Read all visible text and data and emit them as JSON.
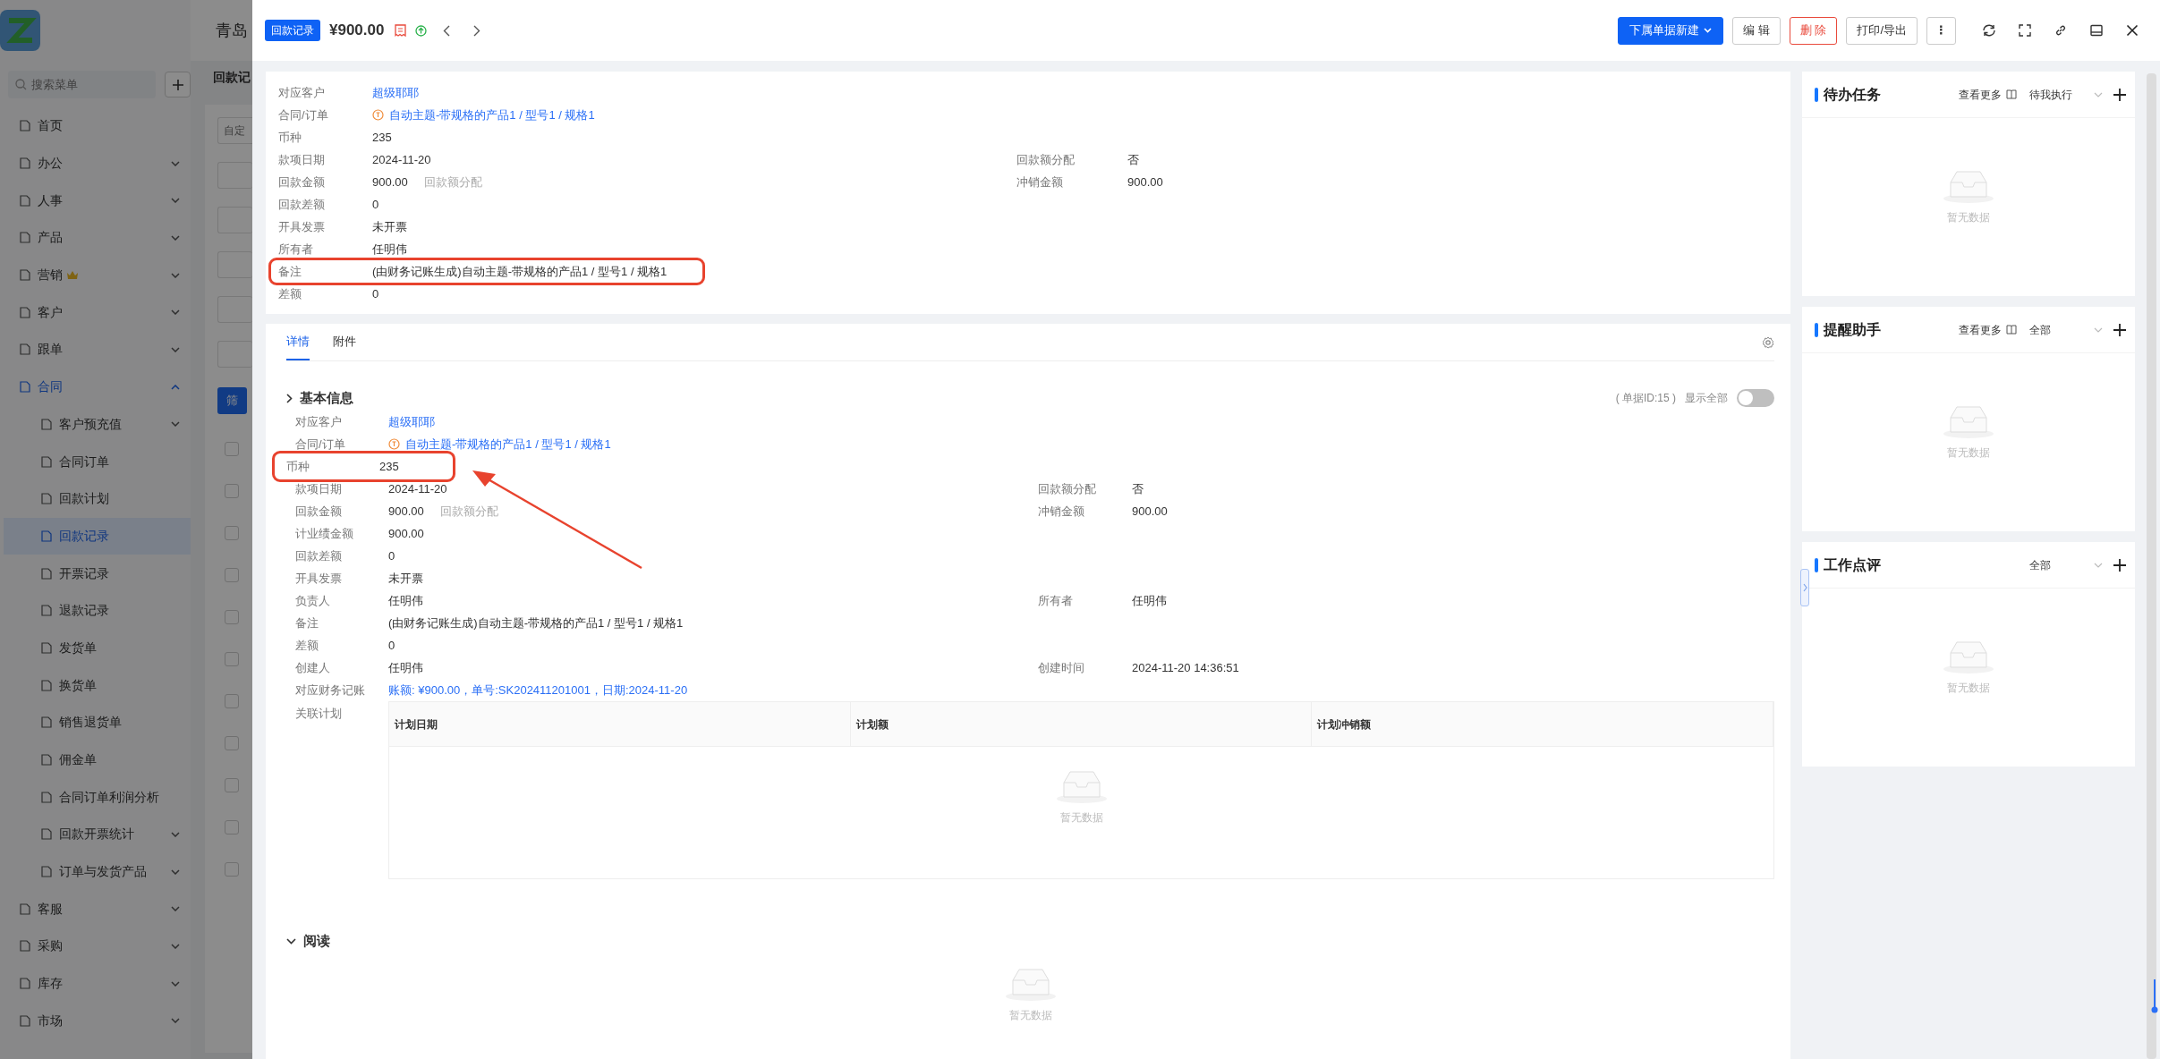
{
  "background_app": {
    "title": "青岛",
    "search": {
      "placeholder": "搜索菜单"
    },
    "page_title": "回款记",
    "filter": {
      "placeholder": "自定"
    },
    "filter_button": "筛",
    "rows": [
      {
        "checked": false
      },
      {
        "checked": false
      },
      {
        "checked": false
      },
      {
        "checked": false
      },
      {
        "checked": false
      },
      {
        "checked": false
      },
      {
        "checked": false
      },
      {
        "checked": false
      },
      {
        "checked": false
      },
      {
        "checked": false
      },
      {
        "checked": false
      }
    ]
  },
  "sidebar": {
    "items": [
      {
        "label": "首页",
        "kind": "link",
        "selected": false
      },
      {
        "label": "办公",
        "kind": "group",
        "expanded": false,
        "selected": false
      },
      {
        "label": "人事",
        "kind": "group",
        "expanded": false,
        "selected": false
      },
      {
        "label": "产品",
        "kind": "group",
        "expanded": false,
        "selected": false
      },
      {
        "label": "营销",
        "kind": "group",
        "expanded": false,
        "selected": false,
        "premium": true
      },
      {
        "label": "客户",
        "kind": "group",
        "expanded": false,
        "selected": false
      },
      {
        "label": "跟单",
        "kind": "group",
        "expanded": false,
        "selected": false
      },
      {
        "label": "合同",
        "kind": "group",
        "expanded": true,
        "selected": false,
        "children": [
          {
            "label": "客户预充值",
            "kind": "group",
            "expanded": false,
            "selected": false
          },
          {
            "label": "合同订单",
            "kind": "link",
            "selected": false
          },
          {
            "label": "回款计划",
            "kind": "link",
            "selected": false
          },
          {
            "label": "回款记录",
            "kind": "link",
            "selected": true
          },
          {
            "label": "开票记录",
            "kind": "link",
            "selected": false
          },
          {
            "label": "退款记录",
            "kind": "link",
            "selected": false
          },
          {
            "label": "发货单",
            "kind": "link",
            "selected": false
          },
          {
            "label": "换货单",
            "kind": "link",
            "selected": false
          },
          {
            "label": "销售退货单",
            "kind": "link",
            "selected": false
          },
          {
            "label": "佣金单",
            "kind": "link",
            "selected": false
          },
          {
            "label": "合同订单利润分析",
            "kind": "link",
            "selected": false
          },
          {
            "label": "回款开票统计",
            "kind": "group",
            "expanded": false,
            "selected": false
          },
          {
            "label": "订单与发货产品",
            "kind": "group",
            "expanded": false,
            "selected": false
          }
        ]
      },
      {
        "label": "客服",
        "kind": "group",
        "expanded": false,
        "selected": false
      },
      {
        "label": "采购",
        "kind": "group",
        "expanded": false,
        "selected": false
      },
      {
        "label": "库存",
        "kind": "group",
        "expanded": false,
        "selected": false
      },
      {
        "label": "市场",
        "kind": "group",
        "expanded": false,
        "selected": false
      }
    ]
  },
  "drawer": {
    "header": {
      "badge": "回款记录",
      "amount": "¥900.00",
      "buttons": [
        {
          "label": "下属单据新建",
          "kind": "primary-dropdown"
        },
        {
          "label": "编 辑",
          "kind": "default"
        },
        {
          "label": "删 除",
          "kind": "danger"
        },
        {
          "label": "打印/导出",
          "kind": "default"
        },
        {
          "label": "⋮",
          "kind": "more"
        }
      ]
    },
    "summary": {
      "rows": [
        {
          "label": "对应客户",
          "value": "超级耶耶",
          "kind": "link",
          "highlighted": false
        },
        {
          "label": "合同/订单",
          "value": "自动主题-带规格的产品1 / 型号1 / 规格1",
          "kind": "order",
          "highlighted": false
        },
        {
          "label": "币种",
          "value": "235",
          "kind": "text",
          "highlighted": false
        },
        {
          "label": "款项日期",
          "value": "2024-11-20",
          "kind": "text",
          "highlighted": false,
          "right": {
            "label": "回款额分配",
            "value": "否"
          }
        },
        {
          "label": "回款金额",
          "value": "900.00",
          "extra": "回款额分配",
          "kind": "text",
          "highlighted": false,
          "right": {
            "label": "冲销金额",
            "value": "900.00"
          }
        },
        {
          "label": "回款差额",
          "value": "0",
          "kind": "text",
          "highlighted": false
        },
        {
          "label": "开具发票",
          "value": "未开票",
          "kind": "text",
          "highlighted": false
        },
        {
          "label": "所有者",
          "value": "任明伟",
          "kind": "text",
          "highlighted": false
        },
        {
          "label": "备注",
          "value": "(由财务记账生成)自动主题-带规格的产品1 / 型号1 / 规格1",
          "kind": "text",
          "highlighted": true
        },
        {
          "label": "差额",
          "value": "0",
          "kind": "text",
          "highlighted": false
        }
      ]
    },
    "tabs": [
      {
        "label": "详情",
        "selected": true
      },
      {
        "label": "附件",
        "selected": false
      }
    ],
    "basic_info": {
      "title": "基本信息",
      "expanded": false,
      "record_id": "( 单据ID:15 )",
      "show_all": {
        "label": "显示全部",
        "on": false
      },
      "rows": [
        {
          "label": "对应客户",
          "value": "超级耶耶",
          "kind": "link",
          "highlighted": false
        },
        {
          "label": "合同/订单",
          "value": "自动主题-带规格的产品1 / 型号1 / 规格1",
          "kind": "order",
          "highlighted": false
        },
        {
          "label": "币种",
          "value": "235",
          "kind": "text",
          "highlighted": true
        },
        {
          "label": "款项日期",
          "value": "2024-11-20",
          "kind": "text",
          "highlighted": false,
          "right": {
            "label": "回款额分配",
            "value": "否"
          }
        },
        {
          "label": "回款金额",
          "value": "900.00",
          "extra": "回款额分配",
          "kind": "text",
          "highlighted": false,
          "right": {
            "label": "冲销金额",
            "value": "900.00"
          }
        },
        {
          "label": "计业绩金额",
          "value": "900.00",
          "kind": "text",
          "highlighted": false
        },
        {
          "label": "回款差额",
          "value": "0",
          "kind": "text",
          "highlighted": false
        },
        {
          "label": "开具发票",
          "value": "未开票",
          "kind": "text",
          "highlighted": false
        },
        {
          "label": "负责人",
          "value": "任明伟",
          "kind": "text",
          "highlighted": false,
          "right": {
            "label": "所有者",
            "value": "任明伟"
          }
        },
        {
          "label": "备注",
          "value": "(由财务记账生成)自动主题-带规格的产品1 / 型号1 / 规格1",
          "kind": "text",
          "highlighted": false
        },
        {
          "label": "差额",
          "value": "0",
          "kind": "text",
          "highlighted": false
        },
        {
          "label": "创建人",
          "value": "任明伟",
          "kind": "text",
          "highlighted": false,
          "right": {
            "label": "创建时间",
            "value": "2024-11-20 14:36:51"
          }
        },
        {
          "label": "对应财务记账",
          "value": "账额: ¥900.00，单号:SK202411201001，日期:2024-11-20",
          "kind": "link",
          "highlighted": false
        }
      ],
      "plan_table": {
        "label": "关联计划",
        "columns": [
          "计划日期",
          "计划额",
          "计划冲销额"
        ],
        "empty_text": "暂无数据"
      }
    },
    "reading": {
      "title": "阅读",
      "expanded": true,
      "empty_text": "暂无数据"
    }
  },
  "side_panels": [
    {
      "title": "待办任务",
      "more": "查看更多",
      "filter": "待我执行",
      "empty_text": "暂无数据"
    },
    {
      "title": "提醒助手",
      "more": "查看更多",
      "filter": "全部",
      "empty_text": "暂无数据"
    },
    {
      "title": "工作点评",
      "filter": "全部",
      "empty_text": "暂无数据"
    }
  ]
}
